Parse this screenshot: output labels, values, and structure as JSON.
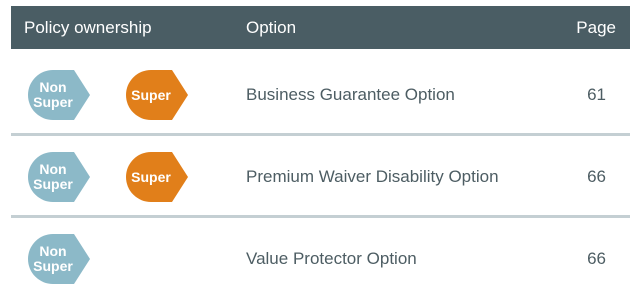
{
  "colors": {
    "header_bg": "#4a5d64",
    "non_super_badge": "#8cb9c8",
    "super_badge": "#e17f1a",
    "row_separator": "#c4cfd3",
    "body_text": "#4d5d63"
  },
  "header": {
    "policy_ownership": "Policy ownership",
    "option": "Option",
    "page": "Page"
  },
  "rows": [
    {
      "badges": [
        {
          "line1": "Non",
          "line2": "Super",
          "type": "non-super"
        },
        {
          "line1": "Super",
          "type": "super"
        }
      ],
      "option": "Business Guarantee Option",
      "page": "61"
    },
    {
      "badges": [
        {
          "line1": "Non",
          "line2": "Super",
          "type": "non-super"
        },
        {
          "line1": "Super",
          "type": "super"
        }
      ],
      "option": "Premium Waiver Disability Option",
      "page": "66"
    },
    {
      "badges": [
        {
          "line1": "Non",
          "line2": "Super",
          "type": "non-super"
        }
      ],
      "option": "Value Protector Option",
      "page": "66"
    }
  ]
}
